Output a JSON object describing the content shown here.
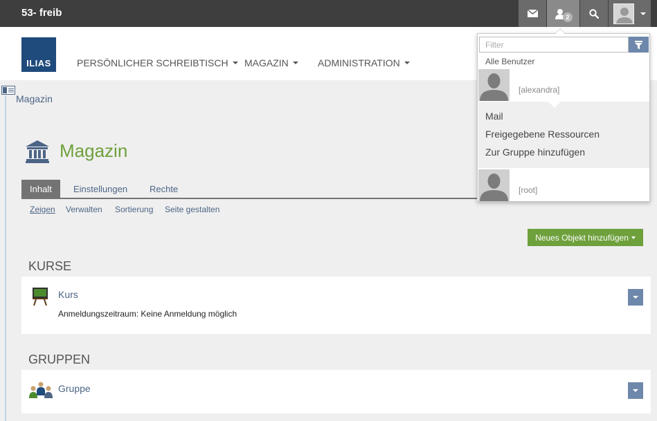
{
  "topbar": {
    "installation": "53- freib",
    "user_badge_count": "2",
    "icons": [
      "mail-icon",
      "users-icon",
      "search-icon",
      "avatar-icon"
    ]
  },
  "header": {
    "logo_text": "ILIAS",
    "menu": [
      {
        "label": "PERSÖNLICHER SCHREIBTISCH"
      },
      {
        "label": "MAGAZIN"
      },
      {
        "label": "ADMINISTRATION"
      }
    ]
  },
  "breadcrumb": "Magazin",
  "page": {
    "title": "Magazin",
    "tabs": [
      {
        "label": "Inhalt"
      },
      {
        "label": "Einstellungen"
      },
      {
        "label": "Rechte"
      }
    ],
    "subtabs": [
      {
        "label": "Zeigen"
      },
      {
        "label": "Verwalten"
      },
      {
        "label": "Sortierung"
      },
      {
        "label": "Seite gestalten"
      }
    ],
    "add_button": "Neues Objekt hinzufügen"
  },
  "sections": [
    {
      "title": "KURSE",
      "items": [
        {
          "title": "Kurs",
          "description": "Anmeldungszeitraum: Keine Anmeldung möglich"
        }
      ]
    },
    {
      "title": "GRUPPEN",
      "items": [
        {
          "title": "Gruppe"
        }
      ]
    }
  ],
  "dropdown": {
    "filter_placeholder": "Filter",
    "all_users_label": "Alle Benutzer",
    "users": [
      {
        "login": "[alexandra]"
      },
      {
        "login": "[root]"
      }
    ],
    "actions": [
      {
        "label": "Mail"
      },
      {
        "label": "Freigegebene Ressourcen"
      },
      {
        "label": "Zur Gruppe hinzufügen"
      }
    ]
  },
  "colors": {
    "topbar": "#3e3e3e",
    "accent_green": "#6ea03c",
    "link_blue": "#4c6586",
    "logo_blue": "#1f4a7c"
  }
}
